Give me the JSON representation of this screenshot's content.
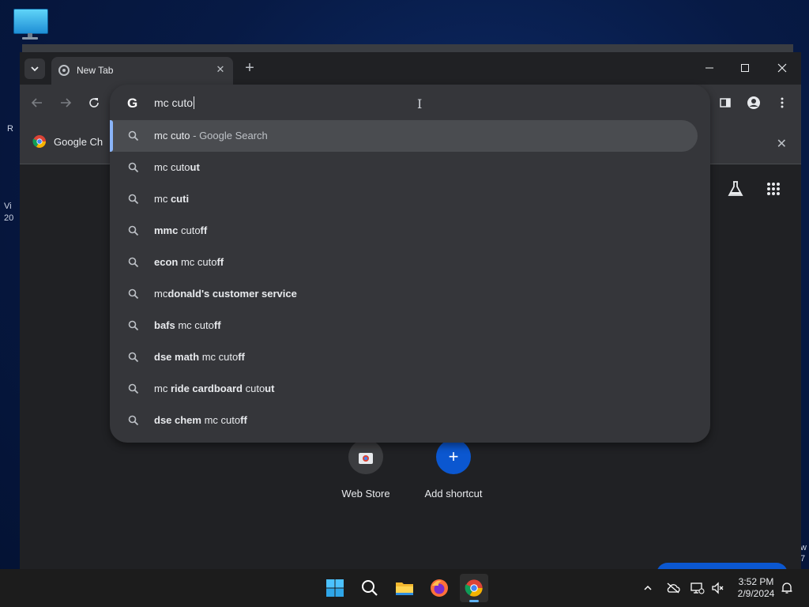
{
  "desktop": {
    "fragments": [
      "R",
      "Vi",
      "20",
      "w",
      "7"
    ]
  },
  "browser": {
    "tab": {
      "title": "New Tab"
    },
    "bookmark": {
      "label": "Google Ch"
    },
    "omnibox": {
      "query": "mc cuto",
      "suggestions": [
        {
          "parts": [
            [
              "mc cuto",
              false
            ],
            [
              " - Google Search",
              false
            ]
          ],
          "selected": true
        },
        {
          "parts": [
            [
              "mc cuto",
              false
            ],
            [
              "ut",
              true
            ]
          ]
        },
        {
          "parts": [
            [
              "mc ",
              false
            ],
            [
              "cuti",
              true
            ]
          ]
        },
        {
          "parts": [
            [
              "mmc",
              true
            ],
            [
              " cuto",
              false
            ],
            [
              "ff",
              true
            ]
          ]
        },
        {
          "parts": [
            [
              "econ",
              true
            ],
            [
              " mc cuto",
              false
            ],
            [
              "ff",
              true
            ]
          ]
        },
        {
          "parts": [
            [
              "mc",
              false
            ],
            [
              "donald's customer service",
              true
            ]
          ]
        },
        {
          "parts": [
            [
              "bafs",
              true
            ],
            [
              " mc cuto",
              false
            ],
            [
              "ff",
              true
            ]
          ]
        },
        {
          "parts": [
            [
              "dse math",
              true
            ],
            [
              " mc cuto",
              false
            ],
            [
              "ff",
              true
            ]
          ]
        },
        {
          "parts": [
            [
              "mc ",
              false
            ],
            [
              "ride cardboard",
              true
            ],
            [
              " cuto",
              false
            ],
            [
              "ut",
              true
            ]
          ]
        },
        {
          "parts": [
            [
              "dse chem",
              true
            ],
            [
              " mc cuto",
              false
            ],
            [
              "ff",
              true
            ]
          ]
        }
      ]
    },
    "shortcuts": [
      {
        "label": "Web Store"
      },
      {
        "label": "Add shortcut"
      }
    ],
    "colors": {
      "accent": "#8ab4f8",
      "panel": "#35363a",
      "frame": "#202124"
    }
  },
  "taskbar": {
    "clock": {
      "time": "3:52 PM",
      "date": "2/9/2024"
    },
    "apps": [
      "start",
      "search",
      "file-explorer",
      "firefox",
      "chrome"
    ]
  }
}
